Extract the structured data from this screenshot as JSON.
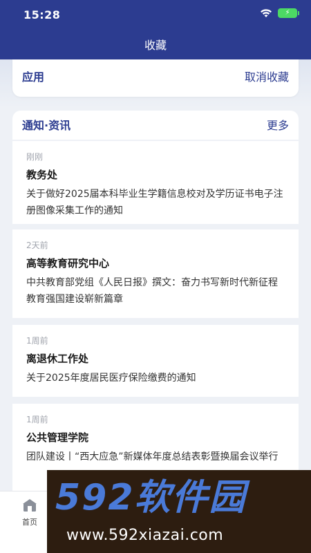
{
  "status_bar": {
    "time": "15:28"
  },
  "header": {
    "title": "收藏",
    "color": "#2c3c90"
  },
  "app_section": {
    "title": "应用",
    "action_label": "取消收藏"
  },
  "news_section": {
    "title": "通知·资讯",
    "more_label": "更多",
    "items": [
      {
        "time": "刚刚",
        "source": "教务处",
        "summary": "关于做好2025届本科毕业生学籍信息校对及学历证书电子注册图像采集工作的通知"
      },
      {
        "time": "2天前",
        "source": "高等教育研究中心",
        "summary": "中共教育部党组《人民日报》撰文：奋力书写新时代新征程教育强国建设崭新篇章"
      },
      {
        "time": "1周前",
        "source": "离退休工作处",
        "summary": "关于2025年度居民医疗保险缴费的通知"
      },
      {
        "time": "1周前",
        "source": "公共管理学院",
        "summary": "团队建设丨“西大应急”新媒体年度总结表彰暨换届会议举行"
      }
    ]
  },
  "tabbar": {
    "home_label": "首页"
  },
  "watermark": {
    "brand": "592软件园",
    "url": "www.592xiazai.com"
  }
}
